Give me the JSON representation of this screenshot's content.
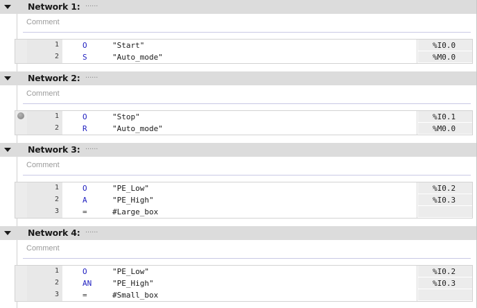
{
  "networks": [
    {
      "title": "Network 1:",
      "dots": "......",
      "comment": "Comment",
      "rows": [
        {
          "line": "1",
          "op": "O",
          "operand": "\"Start\"",
          "address": "%I0.0"
        },
        {
          "line": "2",
          "op": "S",
          "operand": "\"Auto_mode\"",
          "address": "%M0.0"
        }
      ]
    },
    {
      "title": "Network 2:",
      "dots": "......",
      "comment": "Comment",
      "rows": [
        {
          "line": "1",
          "op": "O",
          "operand": "\"Stop\"",
          "address": "%I0.1",
          "breakpoint": true
        },
        {
          "line": "2",
          "op": "R",
          "operand": "\"Auto_mode\"",
          "address": "%M0.0"
        }
      ]
    },
    {
      "title": "Network 3:",
      "dots": "......",
      "comment": "Comment",
      "rows": [
        {
          "line": "1",
          "op": "O",
          "operand": "\"PE_Low\"",
          "address": "%I0.2"
        },
        {
          "line": "2",
          "op": "A",
          "operand": "\"PE_High\"",
          "address": "%I0.3"
        },
        {
          "line": "3",
          "op": "=",
          "operand": "#Large_box",
          "address": ""
        }
      ]
    },
    {
      "title": "Network 4:",
      "dots": "......",
      "comment": "Comment",
      "rows": [
        {
          "line": "1",
          "op": "O",
          "operand": "\"PE_Low\"",
          "address": "%I0.2"
        },
        {
          "line": "2",
          "op": "AN",
          "operand": "\"PE_High\"",
          "address": "%I0.3"
        },
        {
          "line": "3",
          "op": "=",
          "operand": "#Small_box",
          "address": ""
        }
      ]
    }
  ]
}
